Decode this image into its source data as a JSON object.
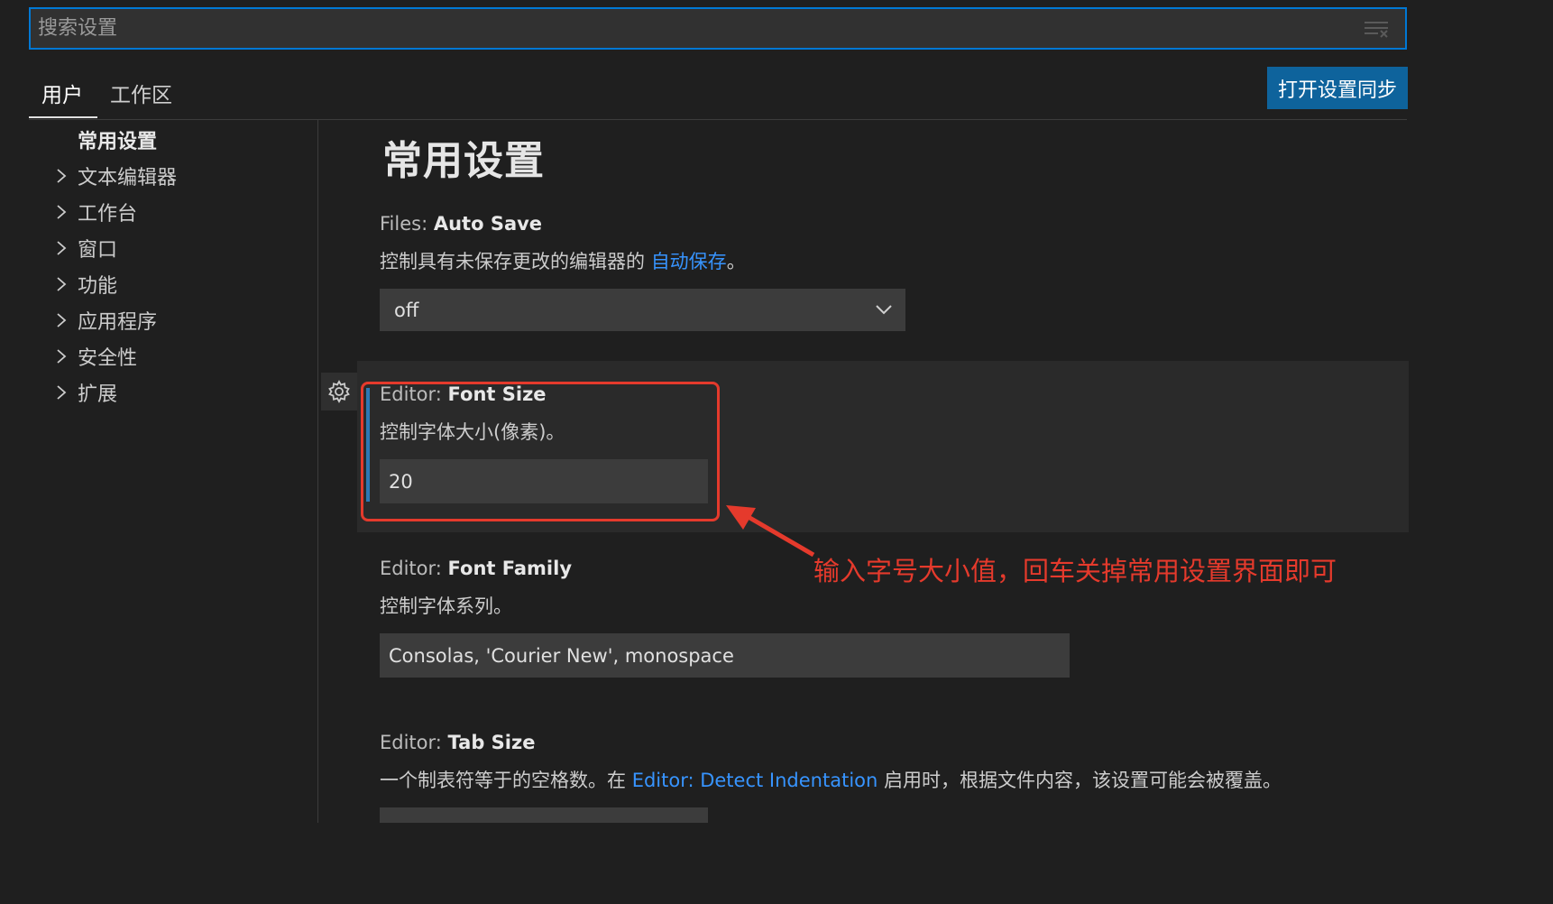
{
  "search": {
    "placeholder": "搜索设置",
    "value": ""
  },
  "tabs": [
    {
      "label": "用户"
    },
    {
      "label": "工作区"
    }
  ],
  "sync_button": {
    "label": "打开设置同步"
  },
  "toc": [
    {
      "label": "常用设置",
      "expandable": false
    },
    {
      "label": "文本编辑器",
      "expandable": true
    },
    {
      "label": "工作台",
      "expandable": true
    },
    {
      "label": "窗口",
      "expandable": true
    },
    {
      "label": "功能",
      "expandable": true
    },
    {
      "label": "应用程序",
      "expandable": true
    },
    {
      "label": "安全性",
      "expandable": true
    },
    {
      "label": "扩展",
      "expandable": true
    }
  ],
  "section_title": "常用设置",
  "settings": {
    "auto_save": {
      "category": "Files: ",
      "name": "Auto Save",
      "desc_prefix": "控制具有未保存更改的编辑器的 ",
      "desc_link": "自动保存",
      "desc_suffix": "。",
      "value": "off"
    },
    "font_size": {
      "category": "Editor: ",
      "name": "Font Size",
      "desc": "控制字体大小(像素)。",
      "value": "20"
    },
    "font_family": {
      "category": "Editor: ",
      "name": "Font Family",
      "desc": "控制字体系列。",
      "value": "Consolas, 'Courier New', monospace"
    },
    "tab_size": {
      "category": "Editor: ",
      "name": "Tab Size",
      "desc_prefix": "一个制表符等于的空格数。在 ",
      "desc_link": "Editor: Detect Indentation",
      "desc_suffix": " 启用时，根据文件内容，该设置可能会被覆盖。",
      "value": ""
    }
  },
  "annotation": "输入字号大小值，回车关掉常用设置界面即可",
  "colors": {
    "background": "#1f1f1f",
    "accent": "#0e639c",
    "focus_border": "#0078d4",
    "link": "#3794ff",
    "annotation": "#e53a2c"
  }
}
